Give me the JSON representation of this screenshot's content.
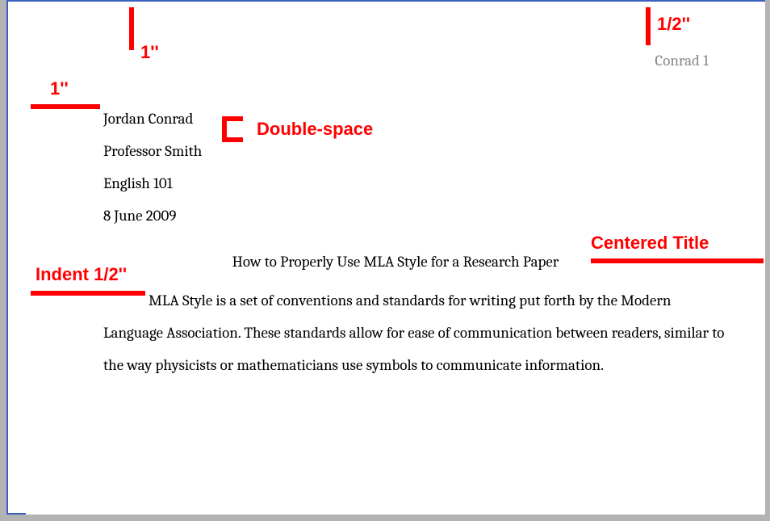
{
  "running_head": "Conrad 1",
  "heading": {
    "author": "Jordan Conrad",
    "instructor": "Professor Smith",
    "course": "English 101",
    "date": "8 June 2009"
  },
  "title": "How to Properly Use MLA Style for a Research Paper",
  "body": "MLA Style is a set of conventions and standards for writing put forth by the Modern Language Association. These standards allow for ease of communication between readers, similar to the way physicists or mathematicians use symbols to communicate information.",
  "annotations": {
    "top_margin": "1''",
    "left_margin": "1''",
    "header_margin": "1/2''",
    "line_spacing": "Double-space",
    "title_note": "Centered Title",
    "indent_note": "Indent 1/2''"
  }
}
